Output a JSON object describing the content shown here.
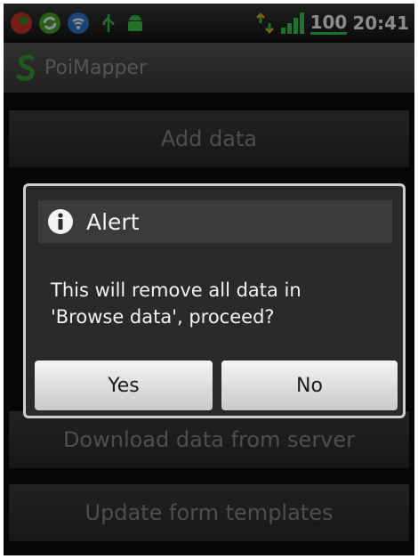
{
  "status_bar": {
    "icons": [
      "app-red-icon",
      "sync-icon",
      "wifi-icon",
      "usb-icon",
      "android-icon",
      "network-icon",
      "signal-bars-icon"
    ],
    "battery": "100",
    "time": "20:41",
    "accent": "#3bd04b"
  },
  "app": {
    "title": "PoiMapper",
    "icon": "poimapper-logo-icon"
  },
  "menu": {
    "add_data": "Add data",
    "download_data": "Download data from server",
    "update_templates": "Update form templates"
  },
  "dialog": {
    "title": "Alert",
    "icon": "info-icon",
    "message_line1": "This will remove all data in",
    "message_line2": "'Browse data', proceed?",
    "yes_label": "Yes",
    "no_label": "No"
  }
}
